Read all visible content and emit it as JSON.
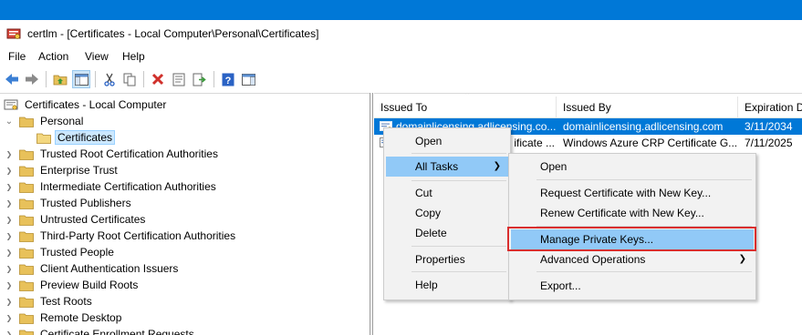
{
  "window": {
    "title": "certlm - [Certificates - Local Computer\\Personal\\Certificates]",
    "app_icon": "certificate-manager-icon"
  },
  "menubar": {
    "items": [
      "File",
      "Action",
      "View",
      "Help"
    ]
  },
  "toolbar": {
    "buttons": [
      "back-icon",
      "forward-icon",
      "up-folder-icon",
      "show-hide-tree-icon",
      "cut-icon",
      "copy-icon",
      "delete-icon",
      "properties-icon",
      "export-icon",
      "help-icon",
      "action-pane-icon"
    ]
  },
  "tree": {
    "root": "Certificates - Local Computer",
    "personal": "Personal",
    "certificates": "Certificates",
    "items": [
      "Trusted Root Certification Authorities",
      "Enterprise Trust",
      "Intermediate Certification Authorities",
      "Trusted Publishers",
      "Untrusted Certificates",
      "Third-Party Root Certification Authorities",
      "Trusted People",
      "Client Authentication Issuers",
      "Preview Build Roots",
      "Test Roots",
      "Remote Desktop",
      "Certificate Enrollment Requests"
    ]
  },
  "list": {
    "columns": [
      "Issued To",
      "Issued By",
      "Expiration D"
    ],
    "rows": [
      {
        "issued_to": "domainlicensing.adlicensing.co...",
        "issued_by": "domainlicensing.adlicensing.com",
        "expiration": "3/11/2034"
      },
      {
        "issued_to": "ificate ...",
        "issued_by": "Windows Azure CRP Certificate G...",
        "expiration": "7/11/2025"
      }
    ]
  },
  "context_menu": {
    "items": [
      "Open",
      "All Tasks",
      "Cut",
      "Copy",
      "Delete",
      "Properties",
      "Help"
    ]
  },
  "submenu": {
    "items": [
      "Open",
      "Request Certificate with New Key...",
      "Renew Certificate with New Key...",
      "Manage Private Keys...",
      "Advanced Operations",
      "Export..."
    ]
  },
  "colors": {
    "selection": "#0078d7",
    "menu_hover": "#91c9f7",
    "highlight_border": "#d92e2e",
    "folder": "#e8c15a"
  }
}
